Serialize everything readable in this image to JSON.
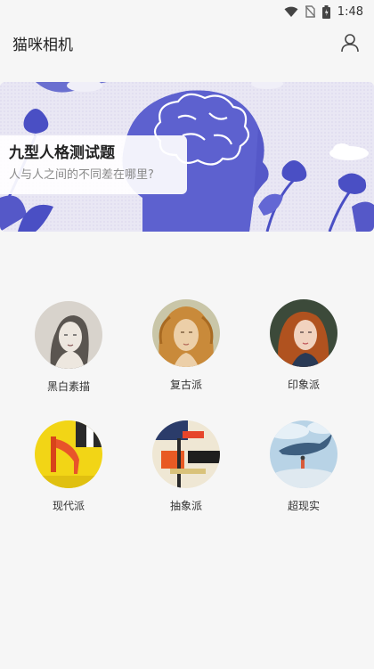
{
  "status_bar": {
    "time": "1:48"
  },
  "app_bar": {
    "title": "猫咪相机"
  },
  "banner": {
    "title": "九型人格测试题",
    "subtitle": "人与人之间的不同差在哪里?"
  },
  "styles": [
    {
      "label": "黑白素描"
    },
    {
      "label": "复古派"
    },
    {
      "label": "印象派"
    },
    {
      "label": "现代派"
    },
    {
      "label": "抽象派"
    },
    {
      "label": "超现实"
    }
  ],
  "colors": {
    "banner_bg": "#e8e6f3",
    "banner_accent": "#4a4fc4",
    "page_bg": "#f6f6f6"
  }
}
